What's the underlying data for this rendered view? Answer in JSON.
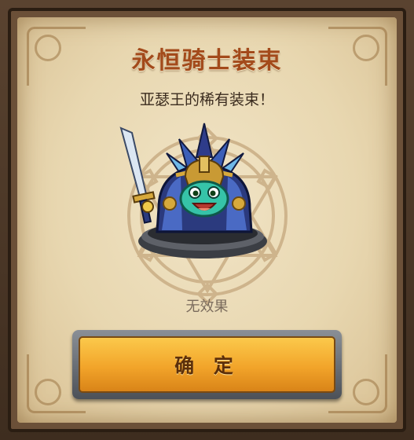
{
  "dialog": {
    "title": "永恒骑士装束",
    "subtitle": "亚瑟王的稀有装束！",
    "effect_text": "无效果",
    "confirm_label": "确 定"
  },
  "item": {
    "icon": "eternal-knight-costume-icon",
    "name": "永恒骑士装束"
  },
  "colors": {
    "title": "#a34a1b",
    "parchment": "#e8d7b0",
    "button": "#f2a42a",
    "button_text": "#5c2f0a",
    "effect_text": "#7a6b5c"
  }
}
